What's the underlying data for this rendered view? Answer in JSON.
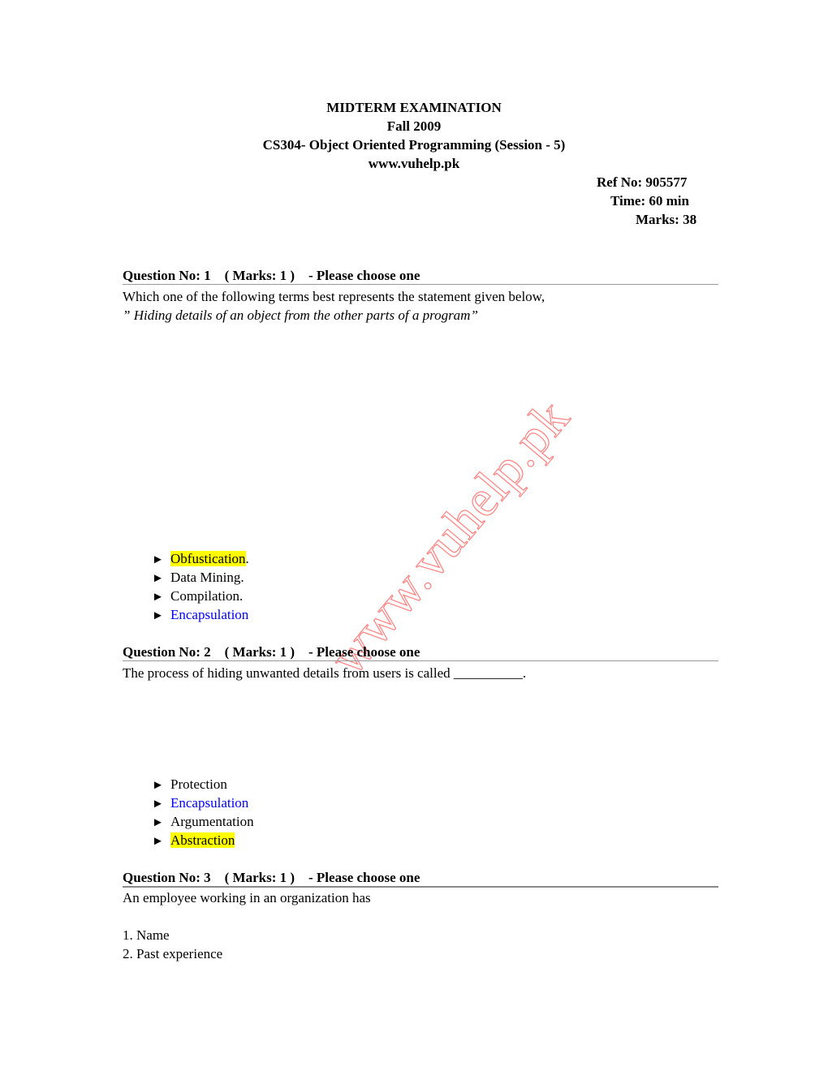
{
  "header": {
    "title": "MIDTERM  EXAMINATION",
    "term": "Fall 2009",
    "course": "CS304- Object Oriented Programming (Session - 5)",
    "website": "www.vuhelp.pk"
  },
  "meta": {
    "ref_no": "Ref No: 905577",
    "time": "Time: 60 min",
    "marks": "Marks: 38"
  },
  "watermark": "www.vuhelp.pk",
  "colors": {
    "highlight": "#ffff00",
    "correct_answer": "#0000ff",
    "watermark": "#ff8080"
  },
  "questions": [
    {
      "heading": "Question No: 1    ( Marks: 1 )    - Please choose one",
      "text": "Which one of the following terms best represents the statement given below,",
      "quote": "” Hiding details of an object from the other parts of a program”",
      "options": [
        {
          "label": "Obfustication",
          "suffix": ".",
          "highlighted": true,
          "blue": false
        },
        {
          "label": "Data Mining.",
          "suffix": "",
          "highlighted": false,
          "blue": false
        },
        {
          "label": "Compilation.",
          "suffix": "",
          "highlighted": false,
          "blue": false
        },
        {
          "label": "Encapsulation",
          "suffix": "",
          "highlighted": false,
          "blue": true
        }
      ]
    },
    {
      "heading": "Question No: 2    ( Marks: 1 )    - Please choose one",
      "text": "The process of hiding unwanted details from users is called __________.",
      "options": [
        {
          "label": "Protection",
          "suffix": "",
          "highlighted": false,
          "blue": false
        },
        {
          "label": "Encapsulation",
          "suffix": "",
          "highlighted": false,
          "blue": true
        },
        {
          "label": "Argumentation",
          "suffix": "",
          "highlighted": false,
          "blue": false
        },
        {
          "label": "Abstraction",
          "suffix": "",
          "highlighted": true,
          "blue": false
        }
      ]
    },
    {
      "heading": "Question No: 3    ( Marks: 1 )    - Please choose one",
      "text": "An employee working in an organization has",
      "items": [
        "1. Name",
        "2. Past experience"
      ]
    }
  ],
  "option_bullet": "►"
}
